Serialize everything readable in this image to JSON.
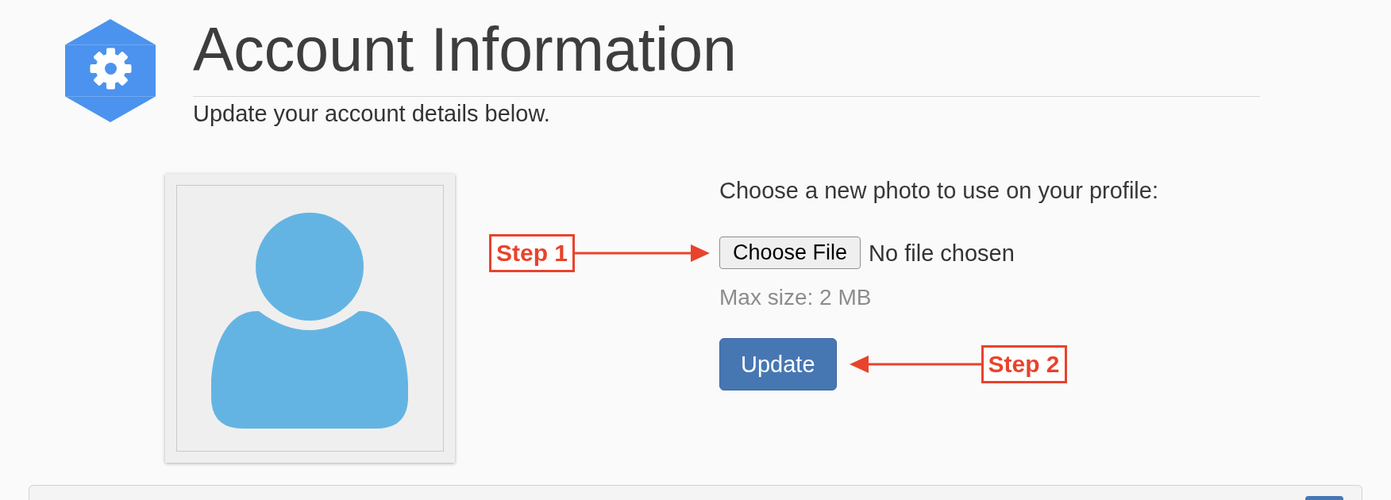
{
  "header": {
    "title": "Account Information",
    "subtitle": "Update your account details below."
  },
  "photo_form": {
    "prompt": "Choose a new photo to use on your profile:",
    "file_button": "Choose File",
    "file_status": "No file chosen",
    "size_hint": "Max size: 2 MB",
    "submit_button": "Update",
    "file_annotation": "Step 1",
    "submit_annotation": "Step 2"
  }
}
